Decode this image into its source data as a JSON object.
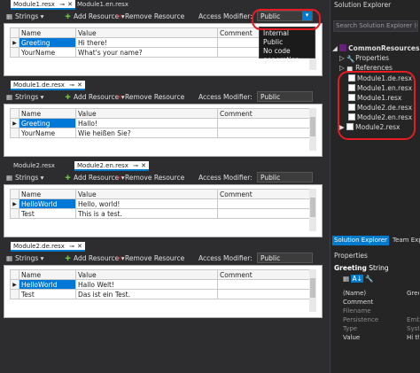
{
  "colors": {
    "accent": "#007acc",
    "selection": "#0078d7",
    "highlight": "#e51c23"
  },
  "toolbar": {
    "strings_label": "Strings",
    "add_label": "Add Resource",
    "remove_label": "Remove Resource",
    "access_label": "Access Modifier:"
  },
  "grid_headers": {
    "name": "Name",
    "value": "Value",
    "comment": "Comment"
  },
  "dropdown": {
    "options": [
      "Internal",
      "Public",
      "No code generation"
    ]
  },
  "panels": [
    {
      "tabs": [
        {
          "label": "Module1.resx",
          "active": true
        },
        {
          "label": "Module1.en.resx",
          "active": false
        }
      ],
      "access_value": "Public",
      "rows": [
        {
          "name": "Greeting",
          "value": "Hi there!"
        },
        {
          "name": "YourName",
          "value": "What's your name?"
        }
      ]
    },
    {
      "tabs": [
        {
          "label": "Module1.de.resx",
          "active": true
        }
      ],
      "access_value": "Public",
      "rows": [
        {
          "name": "Greeting",
          "value": "Hallo!"
        },
        {
          "name": "YourName",
          "value": "Wie heißen Sie?"
        }
      ]
    },
    {
      "tabs": [
        {
          "label": "Module2.resx",
          "active": false
        },
        {
          "label": "Module2.en.resx",
          "active": true
        }
      ],
      "access_value": "Public",
      "rows": [
        {
          "name": "HelloWorld",
          "value": "Hello, world!"
        },
        {
          "name": "Test",
          "value": "This is a test."
        }
      ]
    },
    {
      "tabs": [
        {
          "label": "Module2.de.resx",
          "active": true
        }
      ],
      "access_value": "Public",
      "rows": [
        {
          "name": "HelloWorld",
          "value": "Hallo Welt!"
        },
        {
          "name": "Test",
          "value": "Das ist ein Test."
        }
      ]
    }
  ],
  "solution_explorer": {
    "title": "Solution Explorer",
    "search_placeholder": "Search Solution Explorer (Ctrl+;)",
    "project": "CommonResources",
    "items": [
      "Properties",
      "References",
      "Module1.de.resx",
      "Module1.en.resx",
      "Module1.resx",
      "Module2.de.resx",
      "Module2.en.resx",
      "Module2.resx"
    ],
    "tabs": [
      "Solution Explorer",
      "Team Expl"
    ]
  },
  "properties": {
    "title": "Properties",
    "object_name": "Greeting",
    "object_type": "String",
    "rows": [
      {
        "name": "(Name)",
        "value": "Greet"
      },
      {
        "name": "Comment",
        "value": ""
      },
      {
        "name": "Filename",
        "value": ""
      },
      {
        "name": "Persistence",
        "value": "Embe"
      },
      {
        "name": "Type",
        "value": "Syste"
      },
      {
        "name": "Value",
        "value": "Hi the"
      }
    ]
  }
}
